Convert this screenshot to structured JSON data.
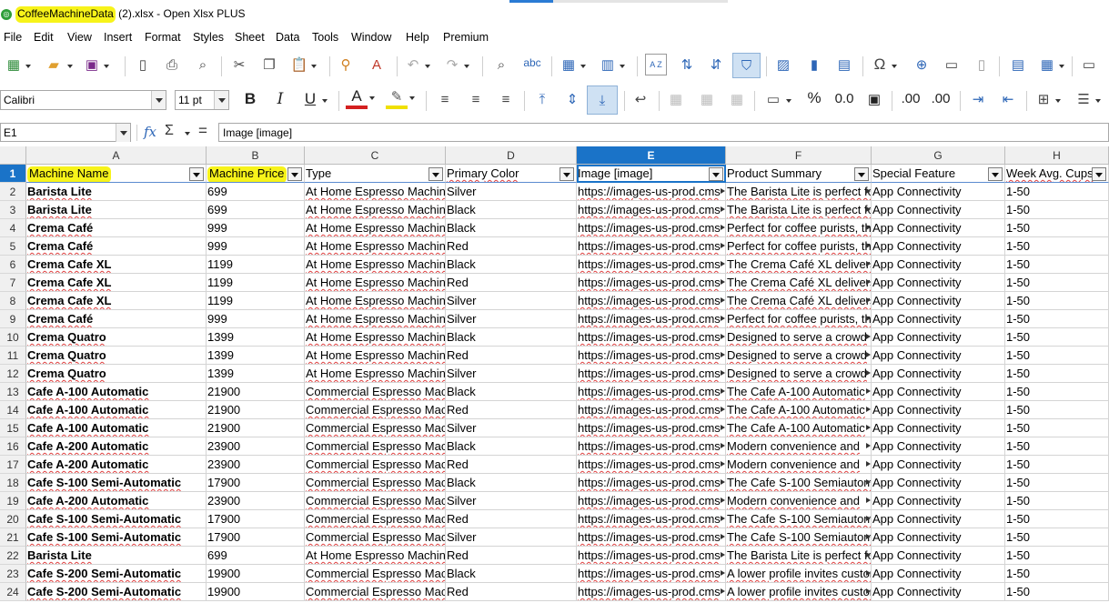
{
  "titlebar": {
    "filename_highlighted": "CoffeeMachineData",
    "title_rest": " (2).xlsx - Open Xlsx PLUS",
    "app_icon": "app-logo-icon"
  },
  "menubar": {
    "items": [
      "File",
      "Edit",
      "View",
      "Insert",
      "Format",
      "Styles",
      "Sheet",
      "Data",
      "Tools",
      "Window",
      "Help",
      "Premium"
    ]
  },
  "toolbar": {
    "font_name": "Calibri",
    "font_size": "11 pt",
    "percent": "%",
    "decimal_format": "0.0",
    "add_decimal": ".00",
    "remove_decimal": ".00",
    "sort_az": "A Z",
    "spellcheck": "abc"
  },
  "formulabar": {
    "cell_ref": "E1",
    "fx": "fx",
    "sigma": "Σ",
    "equals": "=",
    "content": "Image [image]"
  },
  "sheet": {
    "column_letters": [
      "A",
      "B",
      "C",
      "D",
      "E",
      "F",
      "G",
      "H"
    ],
    "selected_column": "E",
    "headers": [
      "Machine Name",
      "Machine Price",
      "Type",
      "Primary Color",
      "Image [image]",
      "Product Summary",
      "Special Feature",
      "Week Avg. Cups"
    ],
    "rows": [
      {
        "n": "2",
        "a": "Barista Lite",
        "b": "699",
        "c": "At Home Espresso Machine",
        "d": "Silver",
        "e": "https://images-us-prod.cms",
        "f": "The Barista Lite is perfect for",
        "g": "App Connectivity",
        "h": "1-50"
      },
      {
        "n": "3",
        "a": "Barista Lite",
        "b": "699",
        "c": "At Home Espresso Machine",
        "d": "Black",
        "e": "https://images-us-prod.cms",
        "f": "The Barista Lite is perfect for",
        "g": "App Connectivity",
        "h": "1-50"
      },
      {
        "n": "4",
        "a": "Crema Café",
        "b": "999",
        "c": "At Home Espresso Machine",
        "d": "Black",
        "e": "https://images-us-prod.cms",
        "f": "Perfect for coffee purists, this",
        "g": "App Connectivity",
        "h": "1-50"
      },
      {
        "n": "5",
        "a": "Crema Café",
        "b": "999",
        "c": "At Home Espresso Machine",
        "d": "Red",
        "e": "https://images-us-prod.cms",
        "f": "Perfect for coffee purists, this",
        "g": "App Connectivity",
        "h": "1-50"
      },
      {
        "n": "6",
        "a": "Crema Cafe XL",
        "b": "1199",
        "c": "At Home Espresso Machine",
        "d": "Black",
        "e": "https://images-us-prod.cms",
        "f": "The Crema Café XL delivers",
        "g": "App Connectivity",
        "h": "1-50"
      },
      {
        "n": "7",
        "a": "Crema Cafe XL",
        "b": "1199",
        "c": "At Home Espresso Machine",
        "d": "Red",
        "e": "https://images-us-prod.cms",
        "f": "The Crema Café XL delivers",
        "g": "App Connectivity",
        "h": "1-50"
      },
      {
        "n": "8",
        "a": "Crema Cafe XL",
        "b": "1199",
        "c": "At Home Espresso Machine",
        "d": "Silver",
        "e": "https://images-us-prod.cms",
        "f": "The Crema Café XL delivers",
        "g": "App Connectivity",
        "h": "1-50"
      },
      {
        "n": "9",
        "a": "Crema Café",
        "b": "999",
        "c": "At Home Espresso Machine",
        "d": "Silver",
        "e": "https://images-us-prod.cms",
        "f": "Perfect for coffee purists, this",
        "g": "App Connectivity",
        "h": "1-50"
      },
      {
        "n": "10",
        "a": "Crema Quatro",
        "b": "1399",
        "c": "At Home Espresso Machine",
        "d": "Black",
        "e": "https://images-us-prod.cms",
        "f": "Designed to serve a crowd",
        "g": "App Connectivity",
        "h": "1-50"
      },
      {
        "n": "11",
        "a": "Crema Quatro",
        "b": "1399",
        "c": "At Home Espresso Machine",
        "d": "Red",
        "e": "https://images-us-prod.cms",
        "f": "Designed to serve a crowd",
        "g": "App Connectivity",
        "h": "1-50"
      },
      {
        "n": "12",
        "a": "Crema Quatro",
        "b": "1399",
        "c": "At Home Espresso Machine",
        "d": "Silver",
        "e": "https://images-us-prod.cms",
        "f": "Designed to serve a crowd",
        "g": "App Connectivity",
        "h": "1-50"
      },
      {
        "n": "13",
        "a": "Cafe A-100 Automatic",
        "b": "21900",
        "c": "Commercial Espresso Machine",
        "d": "Black",
        "e": "https://images-us-prod.cms",
        "f": "The Cafe A-100 Automatic",
        "g": "App Connectivity",
        "h": "1-50"
      },
      {
        "n": "14",
        "a": "Cafe A-100 Automatic",
        "b": "21900",
        "c": "Commercial Espresso Machine",
        "d": "Red",
        "e": "https://images-us-prod.cms",
        "f": "The Cafe A-100 Automatic",
        "g": "App Connectivity",
        "h": "1-50"
      },
      {
        "n": "15",
        "a": "Cafe A-100 Automatic",
        "b": "21900",
        "c": "Commercial Espresso Machine",
        "d": "Silver",
        "e": "https://images-us-prod.cms",
        "f": "The Cafe A-100 Automatic",
        "g": "App Connectivity",
        "h": "1-50"
      },
      {
        "n": "16",
        "a": "Cafe A-200 Automatic",
        "b": "23900",
        "c": "Commercial Espresso Machine",
        "d": "Black",
        "e": "https://images-us-prod.cms",
        "f": "Modern convenience and",
        "g": "App Connectivity",
        "h": "1-50"
      },
      {
        "n": "17",
        "a": "Cafe A-200 Automatic",
        "b": "23900",
        "c": "Commercial Espresso Machine",
        "d": "Red",
        "e": "https://images-us-prod.cms",
        "f": "Modern convenience and",
        "g": "App Connectivity",
        "h": "1-50"
      },
      {
        "n": "18",
        "a": "Cafe S-100 Semi-Automatic",
        "b": "17900",
        "c": "Commercial Espresso Machine",
        "d": "Black",
        "e": "https://images-us-prod.cms",
        "f": "The Cafe S-100 Semiautomatic",
        "g": "App Connectivity",
        "h": "1-50"
      },
      {
        "n": "19",
        "a": "Cafe A-200 Automatic",
        "b": "23900",
        "c": "Commercial Espresso Machine",
        "d": "Silver",
        "e": "https://images-us-prod.cms",
        "f": "Modern convenience and",
        "g": "App Connectivity",
        "h": "1-50"
      },
      {
        "n": "20",
        "a": "Cafe S-100 Semi-Automatic",
        "b": "17900",
        "c": "Commercial Espresso Machine",
        "d": "Red",
        "e": "https://images-us-prod.cms",
        "f": "The Cafe S-100 Semiautomatic",
        "g": "App Connectivity",
        "h": "1-50"
      },
      {
        "n": "21",
        "a": "Cafe S-100 Semi-Automatic",
        "b": "17900",
        "c": "Commercial Espresso Machine",
        "d": "Silver",
        "e": "https://images-us-prod.cms",
        "f": "The Cafe S-100 Semiautomatic",
        "g": "App Connectivity",
        "h": "1-50"
      },
      {
        "n": "22",
        "a": "Barista Lite",
        "b": "699",
        "c": "At Home Espresso Machine",
        "d": "Red",
        "e": "https://images-us-prod.cms",
        "f": "The Barista Lite is perfect for",
        "g": "App Connectivity",
        "h": "1-50"
      },
      {
        "n": "23",
        "a": "Cafe S-200 Semi-Automatic",
        "b": "19900",
        "c": "Commercial Espresso Machine",
        "d": "Black",
        "e": "https://images-us-prod.cms",
        "f": "A lower profile invites customers",
        "g": "App Connectivity",
        "h": "1-50"
      },
      {
        "n": "24",
        "a": "Cafe S-200 Semi-Automatic",
        "b": "19900",
        "c": "Commercial Espresso Machine",
        "d": "Red",
        "e": "https://images-us-prod.cms",
        "f": "A lower profile invites customers",
        "g": "App Connectivity",
        "h": "1-50"
      }
    ]
  },
  "colors": {
    "highlight": "#f7f31a",
    "selection_blue": "#1a73c8",
    "spell_red": "#e04040"
  }
}
